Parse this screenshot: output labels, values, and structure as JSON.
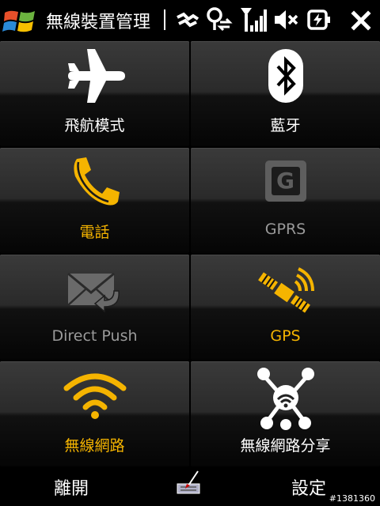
{
  "title": "無線裝置管理",
  "colors": {
    "accent": "#f5b400",
    "white": "#ffffff",
    "disabled": "#9a9a9a"
  },
  "tiles": [
    {
      "label": "飛航模式",
      "icon": "airplane-icon",
      "state": "active-white"
    },
    {
      "label": "藍牙",
      "icon": "bluetooth-icon",
      "state": "active-white"
    },
    {
      "label": "電話",
      "icon": "phone-icon",
      "state": "on"
    },
    {
      "label": "GPRS",
      "icon": "gprs-icon",
      "state": "disabled"
    },
    {
      "label": "Direct Push",
      "icon": "mail-icon",
      "state": "disabled"
    },
    {
      "label": "GPS",
      "icon": "satellite-icon",
      "state": "on"
    },
    {
      "label": "無線網路",
      "icon": "wifi-icon",
      "state": "on"
    },
    {
      "label": "無線網路分享",
      "icon": "network-share-icon",
      "state": "active-white"
    }
  ],
  "softkeys": {
    "left": "離開",
    "right": "設定"
  },
  "gprs_glyph": "G",
  "watermark": "#1381360"
}
